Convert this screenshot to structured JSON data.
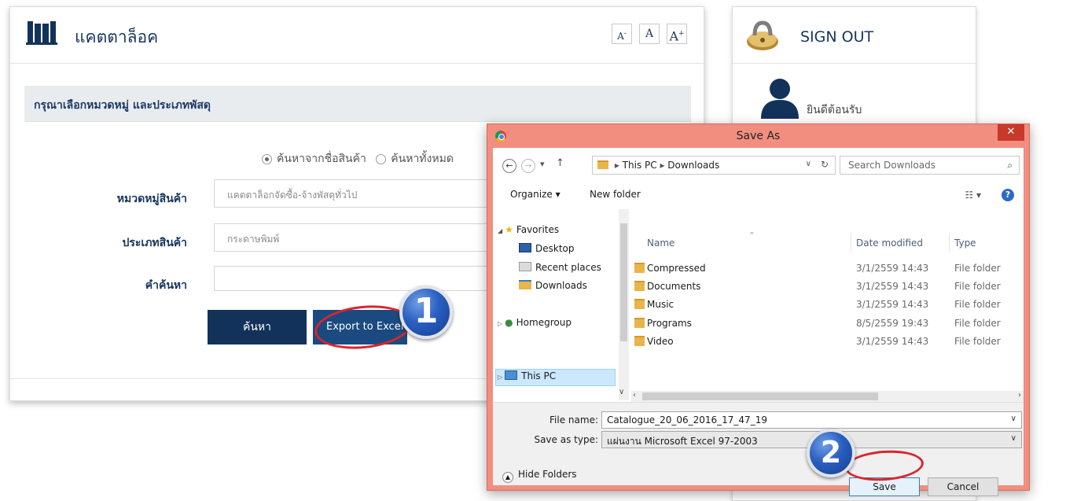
{
  "catalog": {
    "title": "แคตตาล็อค",
    "font_small": "A",
    "font_normal": "A",
    "font_large": "A",
    "section_heading": "กรุณาเลือกหมวดหมู่ และประเภทพัสดุ",
    "radio_product_name": "ค้นหาจากชื่อสินค้า",
    "radio_all": "ค้นหาทั้งหมด",
    "category_label": "หมวดหมู่สินค้า",
    "category_value": "แคตตาล็อกจัดซื้อ-จ้างพัสดุทั่วไป",
    "type_label": "ประเภทสินค้า",
    "type_value": "กระดาษพิมพ์",
    "keyword_label": "คำค้นหา",
    "keyword_value": "",
    "search_button": "ค้นหา",
    "export_button": "Export to Excel"
  },
  "sidebar": {
    "signout_label": "SIGN OUT",
    "welcome_text": "ยินดีต้อนรับ"
  },
  "dialog": {
    "title": "Save As",
    "close": "✕",
    "address": {
      "this_pc": "This PC",
      "downloads": "Downloads"
    },
    "search_placeholder": "Search Downloads",
    "organize_label": "Organize ▾",
    "new_folder_label": "New folder",
    "nav_pane": {
      "favorites": "Favorites",
      "desktop": "Desktop",
      "recent_places": "Recent places",
      "downloads": "Downloads",
      "homegroup": "Homegroup",
      "this_pc": "This PC"
    },
    "columns": {
      "name": "Name",
      "date": "Date modified",
      "type": "Type"
    },
    "files": [
      {
        "name": "Compressed",
        "date": "3/1/2559 14:43",
        "type": "File folder"
      },
      {
        "name": "Documents",
        "date": "3/1/2559 14:43",
        "type": "File folder"
      },
      {
        "name": "Music",
        "date": "3/1/2559 14:43",
        "type": "File folder"
      },
      {
        "name": "Programs",
        "date": "8/5/2559 19:43",
        "type": "File folder"
      },
      {
        "name": "Video",
        "date": "3/1/2559 14:43",
        "type": "File folder"
      }
    ],
    "file_name_label": "File name:",
    "file_name_value": "Catalogue_20_06_2016_17_47_19",
    "save_type_label": "Save as type:",
    "save_type_value": "แผ่นงาน Microsoft Excel 97-2003",
    "hide_folders": "Hide Folders",
    "save_button": "Save",
    "cancel_button": "Cancel"
  },
  "annotations": {
    "step1": "1",
    "step2": "2"
  }
}
